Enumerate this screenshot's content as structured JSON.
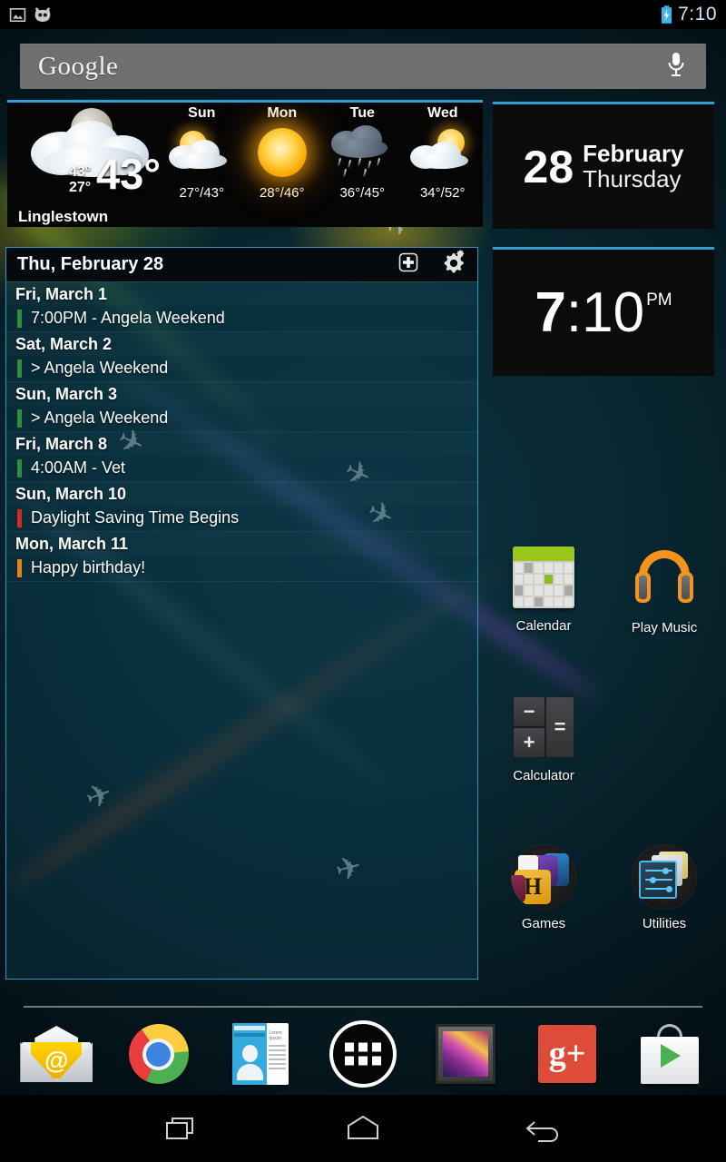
{
  "status_bar": {
    "icons": [
      "image-icon",
      "cyanogenmod-icon"
    ],
    "battery_state": "charging",
    "clock": "7:10"
  },
  "search": {
    "logo_text": "Google",
    "mic_icon": "microphone-icon"
  },
  "weather": {
    "city": "Linglestown",
    "current_temp": "43°",
    "current_high": "43°",
    "current_low": "27°",
    "current_condition": "night-cloudy",
    "forecast": [
      {
        "day": "Sun",
        "condition": "partly-cloudy",
        "temps": "27°/43°"
      },
      {
        "day": "Mon",
        "condition": "sunny",
        "temps": "28°/46°"
      },
      {
        "day": "Tue",
        "condition": "rain",
        "temps": "36°/45°"
      },
      {
        "day": "Wed",
        "condition": "partly-cloudy",
        "temps": "34°/52°"
      }
    ]
  },
  "date_widget": {
    "day_number": "28",
    "month": "February",
    "weekday": "Thursday"
  },
  "clock_widget": {
    "hour": "7",
    "minutes": ":10",
    "ampm": "PM"
  },
  "calendar_widget": {
    "title": "Thu, February 28",
    "add_icon": "add-event-icon",
    "settings_icon": "gear-icon",
    "entries": [
      {
        "type": "date",
        "text": "Fri, March 1"
      },
      {
        "type": "event",
        "text": "7:00PM - Angela Weekend",
        "color": "#2f8f3e"
      },
      {
        "type": "date",
        "text": "Sat, March 2"
      },
      {
        "type": "event",
        "text": "> Angela Weekend",
        "color": "#2f8f3e"
      },
      {
        "type": "date",
        "text": "Sun, March 3"
      },
      {
        "type": "event",
        "text": "> Angela Weekend",
        "color": "#2f8f3e"
      },
      {
        "type": "date",
        "text": "Fri, March 8"
      },
      {
        "type": "event",
        "text": "4:00AM - Vet",
        "color": "#2f8f3e"
      },
      {
        "type": "date",
        "text": "Sun, March 10"
      },
      {
        "type": "event",
        "text": "Daylight Saving Time Begins",
        "color": "#d12a2a"
      },
      {
        "type": "date",
        "text": "Mon, March 11"
      },
      {
        "type": "event",
        "text": "Happy birthday!",
        "color": "#e0831c"
      }
    ]
  },
  "apps": [
    {
      "label": "Calendar",
      "icon": "calendar-app-icon"
    },
    {
      "label": "Play Music",
      "icon": "play-music-icon"
    },
    {
      "label": "Calculator",
      "icon": "calculator-icon"
    },
    {
      "label": "Games",
      "icon": "games-folder-icon"
    },
    {
      "label": "Utilities",
      "icon": "utilities-folder-icon"
    }
  ],
  "calculator_keys": {
    "minus": "−",
    "plus": "+",
    "equals": "="
  },
  "dock": [
    {
      "name": "email",
      "icon": "email-icon",
      "glyph": "@"
    },
    {
      "name": "chrome",
      "icon": "chrome-icon"
    },
    {
      "name": "people",
      "icon": "people-icon",
      "card_label": "Lorem Ipsum"
    },
    {
      "name": "app-drawer",
      "icon": "app-drawer-icon"
    },
    {
      "name": "gallery",
      "icon": "gallery-icon"
    },
    {
      "name": "google-plus",
      "icon": "google-plus-icon",
      "glyph": "g+"
    },
    {
      "name": "play-store",
      "icon": "play-store-icon"
    }
  ],
  "nav_bar": [
    {
      "name": "recents",
      "icon": "recents-icon"
    },
    {
      "name": "home",
      "icon": "home-icon"
    },
    {
      "name": "back",
      "icon": "back-icon"
    }
  ],
  "colors": {
    "accent_blue": "#2f9fd4",
    "widget_border": "#3a93b8",
    "status_clock": "#cfe6f5"
  }
}
